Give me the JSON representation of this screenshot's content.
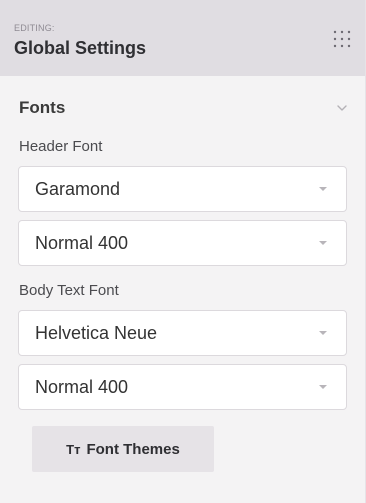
{
  "header": {
    "editing_label": "EDITING:",
    "title": "Global Settings",
    "menu_icon": "grid-menu-icon"
  },
  "fonts_section": {
    "title": "Fonts",
    "collapse_icon": "chevron-down-icon",
    "header_font": {
      "label": "Header Font",
      "family_value": "Garamond",
      "weight_value": "Normal 400"
    },
    "body_font": {
      "label": "Body Text Font",
      "family_value": "Helvetica Neue",
      "weight_value": "Normal 400"
    },
    "font_themes_button": {
      "icon_text": "Tт",
      "label": "Font Themes"
    }
  }
}
